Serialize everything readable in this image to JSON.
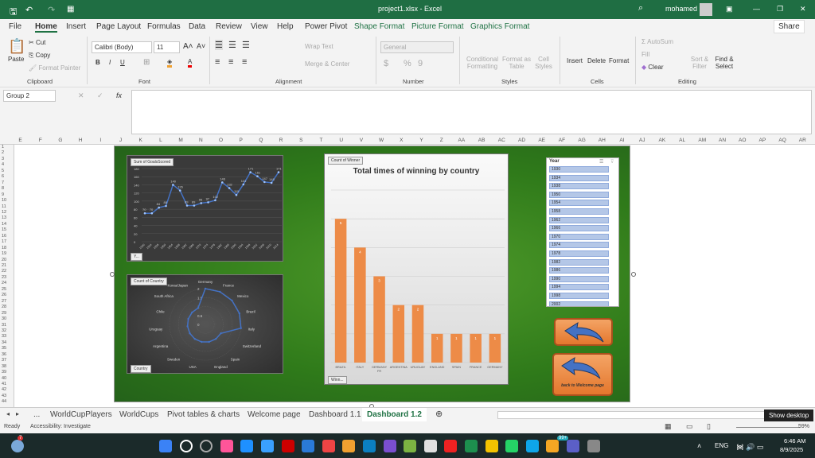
{
  "titlebar": {
    "file": "project1.xlsx - Excel",
    "user": "mohamed"
  },
  "menu": [
    "File",
    "Home",
    "Insert",
    "Page Layout",
    "Formulas",
    "Data",
    "Review",
    "View",
    "Help",
    "Power Pivot"
  ],
  "context_tabs": [
    "Shape Format",
    "Picture Format",
    "Graphics Format"
  ],
  "share": "Share",
  "ribbon": {
    "clipboard": {
      "paste": "Paste",
      "cut": "Cut",
      "copy": "Copy",
      "format_painter": "Format Painter",
      "label": "Clipboard"
    },
    "font": {
      "name": "Calibri (Body)",
      "size": "11",
      "label": "Font",
      "bold": "B",
      "italic": "I",
      "underline": "U"
    },
    "alignment": {
      "wrap": "Wrap Text",
      "merge": "Merge & Center",
      "label": "Alignment"
    },
    "number": {
      "format": "General",
      "label": "Number",
      "currency": "$",
      "percent": "%",
      "comma": "9"
    },
    "styles": {
      "conditional": "Conditional Formatting",
      "format_table": "Format as Table",
      "cell_styles": "Cell Styles",
      "label": "Styles"
    },
    "cells": {
      "insert": "Insert",
      "delete": "Delete",
      "format": "Format",
      "label": "Cells"
    },
    "editing": {
      "autosum": "AutoSum",
      "fill": "Fill",
      "clear": "Clear",
      "sort": "Sort & Filter",
      "find": "Find & Select",
      "label": "Editing"
    }
  },
  "formula_bar": {
    "name_box": "Group 2",
    "fx": "fx",
    "value": ""
  },
  "columns": [
    "E",
    "F",
    "G",
    "H",
    "I",
    "J",
    "K",
    "L",
    "M",
    "N",
    "O",
    "P",
    "Q",
    "R",
    "S",
    "T",
    "U",
    "V",
    "W",
    "X",
    "Y",
    "Z",
    "AA",
    "AB",
    "AC",
    "AD",
    "AE",
    "AF",
    "AG",
    "AH",
    "AI",
    "AJ",
    "AK",
    "AL",
    "AM",
    "AN",
    "AO",
    "AP",
    "AQ",
    "AR"
  ],
  "chart_data": [
    {
      "type": "line",
      "tag": "Sum of GoalsScored",
      "filter_button": "Y...",
      "x": [
        "1930",
        "1934",
        "1938",
        "1950",
        "1954",
        "1958",
        "1962",
        "1966",
        "1970",
        "1974",
        "1978",
        "1982",
        "1986",
        "1990",
        "1994",
        "1998",
        "2002",
        "2006",
        "2010",
        "2014"
      ],
      "values": [
        70,
        70,
        84,
        88,
        140,
        126,
        89,
        89,
        95,
        97,
        102,
        146,
        132,
        115,
        141,
        171,
        161,
        147,
        145,
        171
      ],
      "yticks": [
        0,
        20,
        40,
        60,
        80,
        100,
        120,
        140,
        160,
        180
      ],
      "ylim": [
        0,
        180
      ],
      "grid": true,
      "color": "#4472c4"
    },
    {
      "type": "radar",
      "tag": "Count of Country",
      "filter_button": "Country",
      "categories": [
        "Germany",
        "France",
        "Mexico",
        "Brazil",
        "Italy",
        "Switzerland",
        "Spain",
        "England",
        "USA",
        "Sweden",
        "Argentina",
        "Uruguay",
        "Chile",
        "South Africa",
        "Korea/Japan"
      ],
      "values": [
        2,
        2,
        2,
        2,
        2,
        1,
        1,
        1,
        1,
        1,
        1,
        1,
        1,
        1,
        1
      ],
      "rticks": [
        "0",
        "0.5",
        "1",
        "1.5",
        "2"
      ],
      "rlim": [
        0,
        2
      ],
      "color": "#4472c4"
    },
    {
      "type": "bar",
      "tag": "Count of Winner",
      "filter_button": "Winn...",
      "title": "Total times of winning by country",
      "categories": [
        "BRAZIL",
        "ITALY",
        "GERMANY FR",
        "ARGENTINA",
        "URUGUAY",
        "ENGLAND",
        "SPAIN",
        "FRANCE",
        "GERMANY"
      ],
      "values": [
        5,
        4,
        3,
        2,
        2,
        1,
        1,
        1,
        1
      ],
      "ylim": [
        0,
        6
      ],
      "grid": true,
      "color": "#ed8b47"
    }
  ],
  "slicer": {
    "title": "Year",
    "items": [
      "1930",
      "1934",
      "1938",
      "1950",
      "1954",
      "1958",
      "1962",
      "1966",
      "1970",
      "1974",
      "1978",
      "1982",
      "1986",
      "1990",
      "1994",
      "1998",
      "2002"
    ]
  },
  "buttons": {
    "back_label": "back to Welcome page"
  },
  "sheet_tabs": [
    "WorldCupPlayers",
    "WorldCups",
    "Pivot tables & charts",
    "Welcome page",
    "Dashboard 1.1",
    "Dashboard 1.2"
  ],
  "active_tab": "Dashboard 1.2",
  "status": {
    "ready": "Ready",
    "accessibility": "Accessibility: Investigate",
    "zoom": "59%",
    "tooltip": "Show desktop"
  },
  "taskbar": {
    "lang": "ENG",
    "time": "6:46 AM",
    "date": "8/9/2025",
    "weather_badge": "7",
    "whatsapp_badge": "99+"
  }
}
